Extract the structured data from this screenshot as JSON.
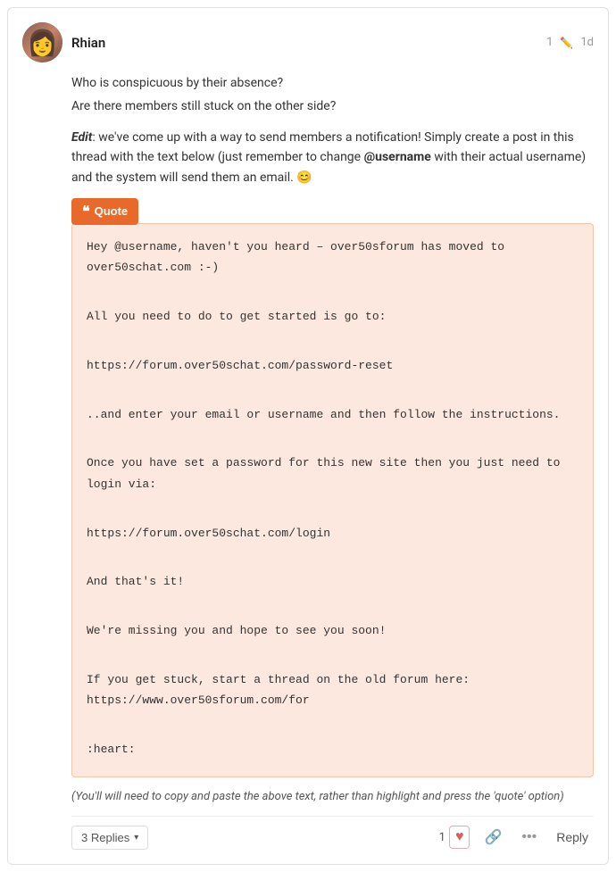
{
  "post": {
    "username": "Rhian",
    "edit_count": "1",
    "time_ago": "1d",
    "avatar_emoji": "👩",
    "body": {
      "line1": "Who is conspicuous by their absence?",
      "line2": "Are there members still stuck on the other side?",
      "edit_prefix": "Edit",
      "edit_text": ": we've come up with a way to send members a notification! Simply create a post in this thread with the text below (just remember to change ",
      "bold_username": "@username",
      "edit_text2": " with their actual username) and the system will send them an email. 😊"
    },
    "quote_button_label": "Quote",
    "blockquote_lines": [
      "Hey @username, haven't you heard – over50sforum has moved to over50schat.com :-)",
      "",
      "All you need to do to get started is go to:",
      "",
      "https://forum.over50schat.com/password-reset",
      "",
      "..and enter your email or username and then follow the instructions.",
      "",
      "Once you have set a password for this new site then you just need to login via:",
      "",
      "https://forum.over50schat.com/login",
      "",
      "And that's it!",
      "",
      "We're missing you and hope to see you soon!",
      "",
      "If you get stuck, start a thread on the old forum here: https://www.over50sforum.com/for",
      "",
      ":heart:"
    ],
    "footer_note": "(You'll will need to copy and paste the above text, rather than highlight and press the 'quote' option)",
    "replies_label": "3 Replies",
    "like_count": "1",
    "reply_label": "Reply"
  }
}
